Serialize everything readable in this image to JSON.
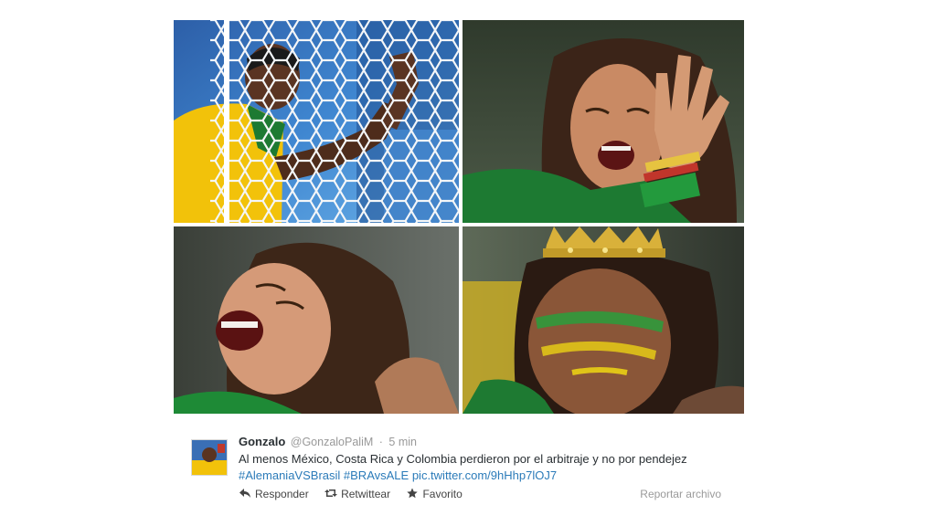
{
  "photos": [
    {
      "subject": "player-at-net"
    },
    {
      "subject": "crying-fan-hand"
    },
    {
      "subject": "crying-fan-screaming"
    },
    {
      "subject": "crying-fan-crown-facepaint"
    }
  ],
  "tweet": {
    "author_name": "Gonzalo",
    "handle": "@GonzaloPaliM",
    "separator": "·",
    "time": "5 min",
    "text_plain": "Al menos México, Costa Rica y Colombia perdieron por el arbitraje y no por pendejez",
    "hashtags": [
      "#AlemaniaVSBrasil",
      "#BRAvsALE"
    ],
    "link": "pic.twitter.com/9hHhp7lOJ7",
    "actions": {
      "reply": "Responder",
      "retweet": "Retwittear",
      "favorite": "Favorito"
    },
    "report": "Reportar archivo"
  },
  "colors": {
    "link": "#2b7bb9",
    "text": "#292f33",
    "muted": "#999999",
    "brazil_yellow": "#f5c400",
    "brazil_green": "#1e7a2e"
  }
}
